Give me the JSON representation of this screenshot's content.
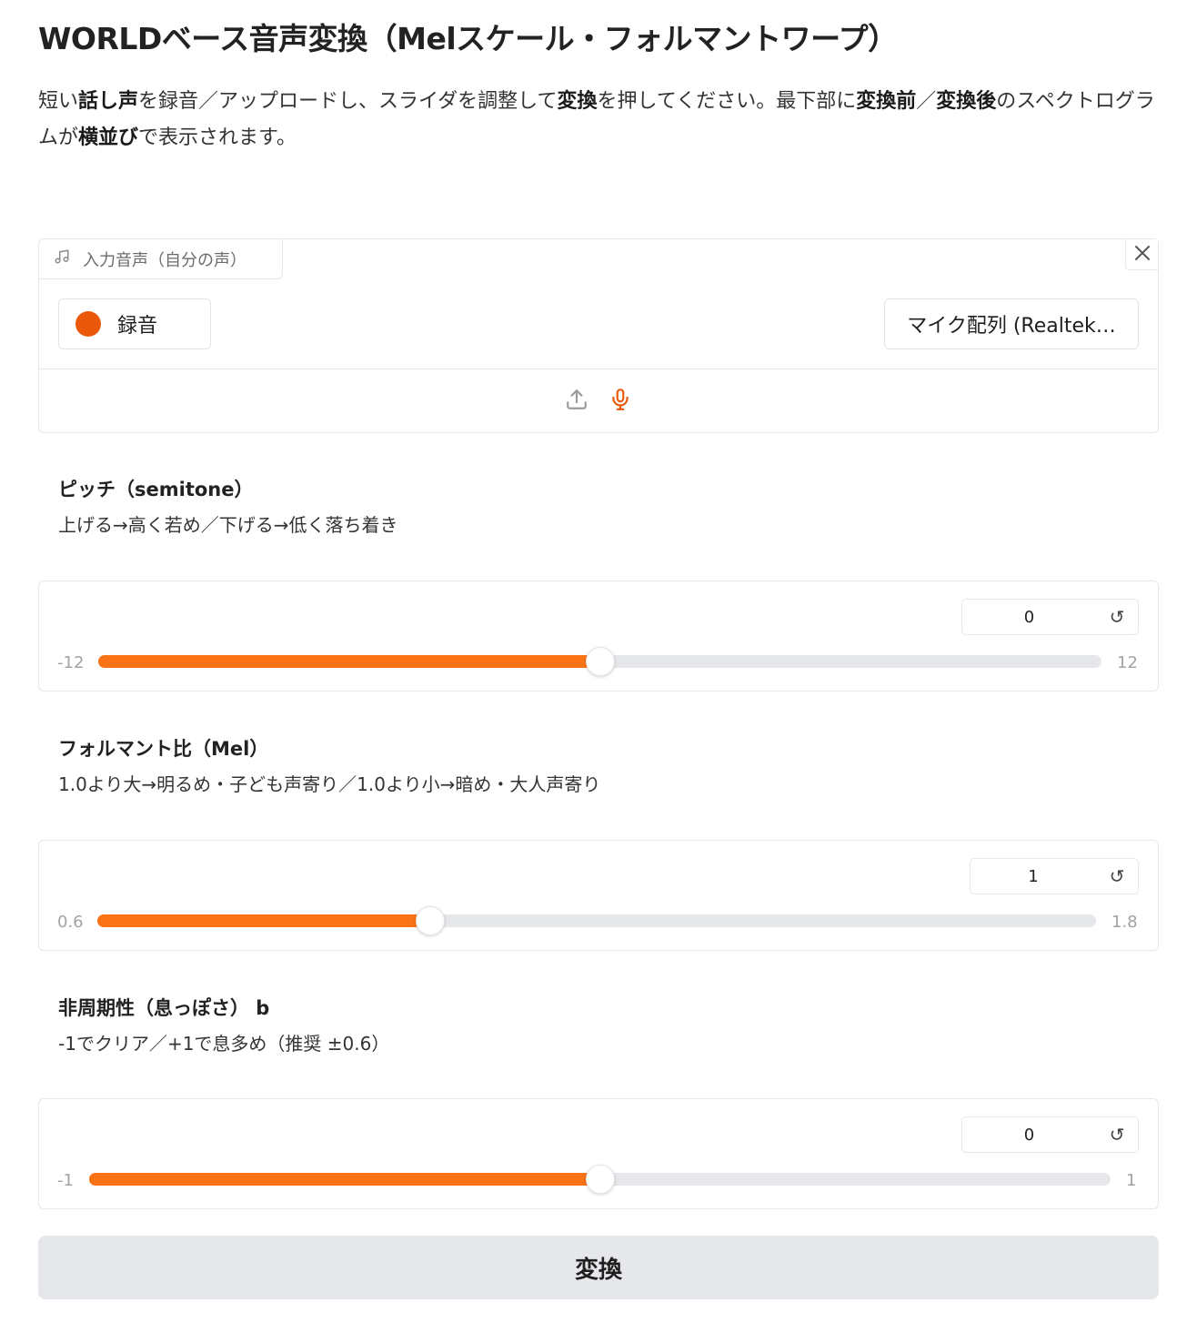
{
  "page": {
    "title": "WORLDベース音声変換（Melスケール・フォルマントワープ）",
    "description": [
      {
        "text": "短い",
        "bold": false
      },
      {
        "text": "話し声",
        "bold": true
      },
      {
        "text": "を録音／アップロードし、スライダを調整して",
        "bold": false
      },
      {
        "text": "変換",
        "bold": true
      },
      {
        "text": "を押してください。最下部に",
        "bold": false
      },
      {
        "text": "変換前",
        "bold": true
      },
      {
        "text": "／",
        "bold": false
      },
      {
        "text": "変換後",
        "bold": true
      },
      {
        "text": "のスペクトログラムが",
        "bold": false
      },
      {
        "text": "横並び",
        "bold": true
      },
      {
        "text": "で表示されます。",
        "bold": false
      }
    ]
  },
  "audio_input": {
    "label": "入力音声（自分の声）",
    "record_label": "録音",
    "device_label": "マイク配列 (Realtek…",
    "icons": [
      "music-note-icon",
      "close-icon",
      "upload-icon",
      "microphone-icon"
    ],
    "accent_color": "#ea580c"
  },
  "sliders": [
    {
      "label": "ピッチ（semitone）",
      "info": "上げる→高く若め／下げる→低く落ち着き",
      "min": -12,
      "max": 12,
      "value": 0,
      "min_label": "-12",
      "max_label": "12",
      "value_label": "0"
    },
    {
      "label": "フォルマント比（Mel）",
      "info": "1.0より大→明るめ・子ども声寄り／1.0より小→暗め・大人声寄り",
      "min": 0.6,
      "max": 1.8,
      "value": 1,
      "min_label": "0.6",
      "max_label": "1.8",
      "value_label": "1"
    },
    {
      "label": "非周期性（息っぽさ） b",
      "info": "-1でクリア／+1で息多め（推奨 ±0.6）",
      "min": -1,
      "max": 1,
      "value": 0,
      "min_label": "-1",
      "max_label": "1",
      "value_label": "0"
    }
  ],
  "slider_color": "#f97316",
  "reset_icon": "reset-icon",
  "convert_label": "変換"
}
